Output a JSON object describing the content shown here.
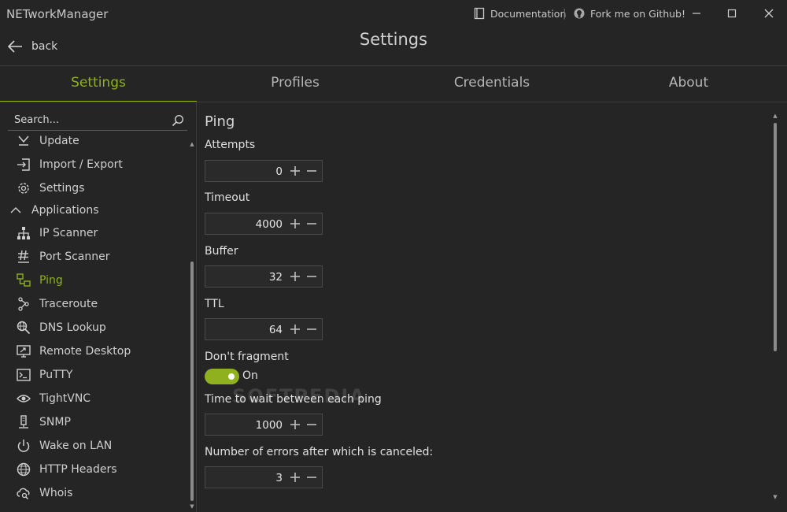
{
  "window": {
    "title": "NETworkManager"
  },
  "titlebar": {
    "documentation": "Documentation",
    "separator": "|",
    "github": "Fork me on Github!"
  },
  "header": {
    "back_label": "back",
    "title": "Settings"
  },
  "tabs": [
    {
      "label": "Settings",
      "active": true
    },
    {
      "label": "Profiles",
      "active": false
    },
    {
      "label": "Credentials",
      "active": false
    },
    {
      "label": "About",
      "active": false
    }
  ],
  "sidebar": {
    "search_placeholder": "Search...",
    "items": [
      {
        "label": "Update",
        "icon": "update-icon"
      },
      {
        "label": "Import / Export",
        "icon": "import-export-icon"
      },
      {
        "label": "Settings",
        "icon": "gear-icon"
      },
      {
        "label": "Applications",
        "icon": "chevron-up-icon",
        "group": true
      },
      {
        "label": "IP Scanner",
        "icon": "network-tree-icon"
      },
      {
        "label": "Port Scanner",
        "icon": "hash-icon"
      },
      {
        "label": "Ping",
        "icon": "ping-icon",
        "active": true
      },
      {
        "label": "Traceroute",
        "icon": "traceroute-icon"
      },
      {
        "label": "DNS Lookup",
        "icon": "dns-lookup-icon"
      },
      {
        "label": "Remote Desktop",
        "icon": "remote-desktop-icon"
      },
      {
        "label": "PuTTY",
        "icon": "terminal-icon"
      },
      {
        "label": "TightVNC",
        "icon": "eye-icon"
      },
      {
        "label": "SNMP",
        "icon": "server-icon"
      },
      {
        "label": "Wake on LAN",
        "icon": "power-icon"
      },
      {
        "label": "HTTP Headers",
        "icon": "globe-icon"
      },
      {
        "label": "Whois",
        "icon": "cloud-search-icon"
      }
    ]
  },
  "content": {
    "title": "Ping",
    "attempts": {
      "label": "Attempts",
      "value": "0"
    },
    "timeout": {
      "label": "Timeout",
      "value": "4000"
    },
    "buffer": {
      "label": "Buffer",
      "value": "32"
    },
    "ttl": {
      "label": "TTL",
      "value": "64"
    },
    "dont_fragment": {
      "label": "Don't fragment",
      "state": "On"
    },
    "wait_time": {
      "label": "Time to wait between each ping",
      "value": "1000"
    },
    "errors": {
      "label": "Number of errors after which is canceled:",
      "value": "3"
    }
  },
  "watermark": "SOFTPEDIA",
  "colors": {
    "accent": "#8fb01f",
    "background": "#252525",
    "text": "#d6d6d6"
  }
}
